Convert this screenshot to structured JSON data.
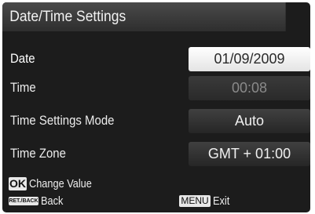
{
  "title": "Date/Time Settings",
  "rows": [
    {
      "label": "Date",
      "value": "01/09/2009",
      "state": "selected"
    },
    {
      "label": "Time",
      "value": "00:08",
      "state": "dim"
    },
    {
      "label": "Time Settings Mode",
      "value": "Auto",
      "state": "normal"
    },
    {
      "label": "Time Zone",
      "value": "GMT + 01:00",
      "state": "normal"
    }
  ],
  "footer": {
    "ok_key": "OK",
    "ok_hint": "Change Value",
    "back_key": "RET./BACK",
    "back_hint": "Back",
    "menu_key": "MENU",
    "menu_hint": "Exit"
  }
}
